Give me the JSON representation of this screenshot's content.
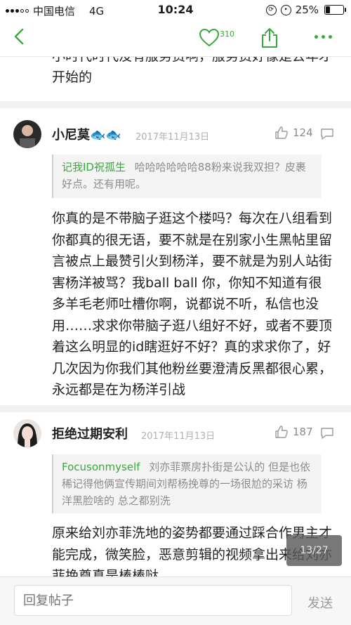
{
  "status_bar": {
    "carrier": "中国电信",
    "network": "4G",
    "time": "10:24",
    "battery": "25%"
  },
  "nav": {
    "like_count": "310",
    "accent_color": "#3aa83a"
  },
  "previous_comment_tail": "小时代时代没有服务费啊，服务费好像是去年才开始的",
  "comments": [
    {
      "username": "小尼莫🐟🐟",
      "date": "2017年11月13日",
      "likes": "124",
      "quote_user": "记我ID祝孤生",
      "quote_text": "哈哈哈哈哈哈88粉来说我双担？皮裹好点。还有用呢。",
      "body": "你真的是不带脑子逛这个楼吗？每次在八组看到你都真的很无语，要不就是在别家小生黑帖里留言被点上最赞引火到杨洋，要不就是为别人站街害杨洋被骂？我ball ball 你，你知不知道有很多羊毛老师吐槽你啊，说都说不听，私信也没用……求求你带脑子逛八组好不好，或者不要顶着这么明显的id瞎逛好不好？真的求求你了，好几次因为你我们其他粉丝要澄清反黑都很心累，永远都是在为杨洋引战"
    },
    {
      "username": "拒绝过期安利",
      "date": "2017年11月13日",
      "likes": "187",
      "quote_user": "Focusonmyself",
      "quote_text": "刘亦菲票房扑街是公认的 但是也依稀记得他俩宣传期间刘帮杨挽尊的一场很尬的采访 杨洋黑脸啥的 总之都别洗",
      "body": "原来给刘亦菲洗地的姿势都要通过踩合作男主才能完成，微笑脸，恶意剪辑的视频拿出来给刘亦菲挽尊真是棒棒哒"
    }
  ],
  "page_indicator": "13/27",
  "reply_bar": {
    "placeholder": "回复帖子",
    "send_label": "发送"
  }
}
